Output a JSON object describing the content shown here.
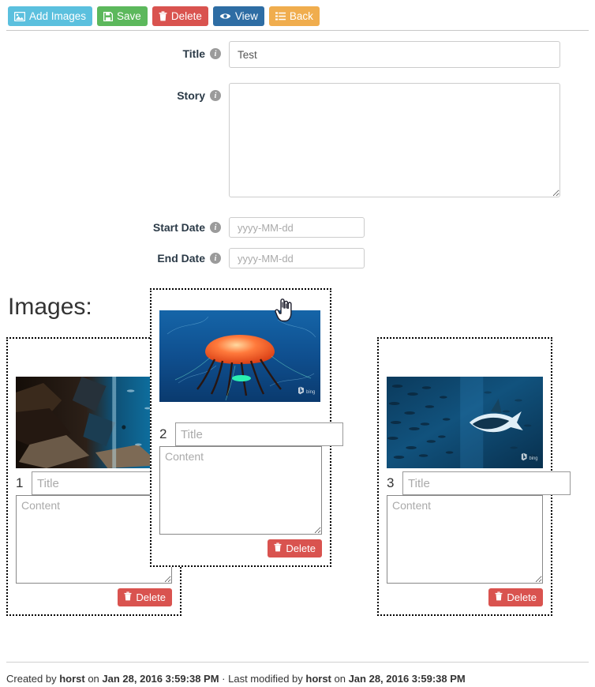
{
  "toolbar": {
    "buttons": [
      {
        "label": "Add Images",
        "icon": "image-icon",
        "style": "info"
      },
      {
        "label": "Save",
        "icon": "save-icon",
        "style": "success"
      },
      {
        "label": "Delete",
        "icon": "trash-icon",
        "style": "danger"
      },
      {
        "label": "View",
        "icon": "eye-icon",
        "style": "primary"
      },
      {
        "label": "Back",
        "icon": "list-icon",
        "style": "warning"
      }
    ]
  },
  "form": {
    "title": {
      "label": "Title",
      "value": "Test",
      "placeholder": "",
      "info_icon": "info-icon"
    },
    "story": {
      "label": "Story",
      "value": "",
      "placeholder": "",
      "info_icon": "info-icon"
    },
    "start_date": {
      "label": "Start Date",
      "value": "",
      "placeholder": "yyyy-MM-dd",
      "info_icon": "info-icon"
    },
    "end_date": {
      "label": "End Date",
      "value": "",
      "placeholder": "yyyy-MM-dd",
      "info_icon": "info-icon"
    }
  },
  "images_section": {
    "heading": "Images:",
    "cards": [
      {
        "number": "1",
        "title_value": "",
        "title_placeholder": "Title",
        "content_value": "",
        "content_placeholder": "Content",
        "delete_label": "Delete",
        "image_alt": "underwater-rocky-canyon-photo",
        "image_watermark": "bing",
        "dragging": false
      },
      {
        "number": "2",
        "title_value": "",
        "title_placeholder": "Title",
        "content_value": "",
        "content_placeholder": "Content",
        "delete_label": "Delete",
        "image_alt": "orange-jellyfish-photo",
        "image_watermark": "bing",
        "dragging": true
      },
      {
        "number": "3",
        "title_value": "",
        "title_placeholder": "Title",
        "content_value": "",
        "content_placeholder": "Content",
        "delete_label": "Delete",
        "image_alt": "dolphin-and-fish-school-photo",
        "image_watermark": "bing",
        "dragging": false
      }
    ]
  },
  "footer": {
    "created_prefix": "Created by ",
    "created_user": "horst",
    "created_mid": " on ",
    "created_date": "Jan 28, 2016 3:59:38 PM",
    "separator": " · ",
    "modified_prefix": "Last modified by ",
    "modified_user": "horst",
    "modified_mid": " on ",
    "modified_date": "Jan 28, 2016 3:59:38 PM"
  },
  "colors": {
    "info": "#5bc0de",
    "success": "#5cb85c",
    "danger": "#d9534f",
    "primary": "#2e6da4",
    "warning": "#f0ad4e",
    "card_border": "#000000"
  }
}
